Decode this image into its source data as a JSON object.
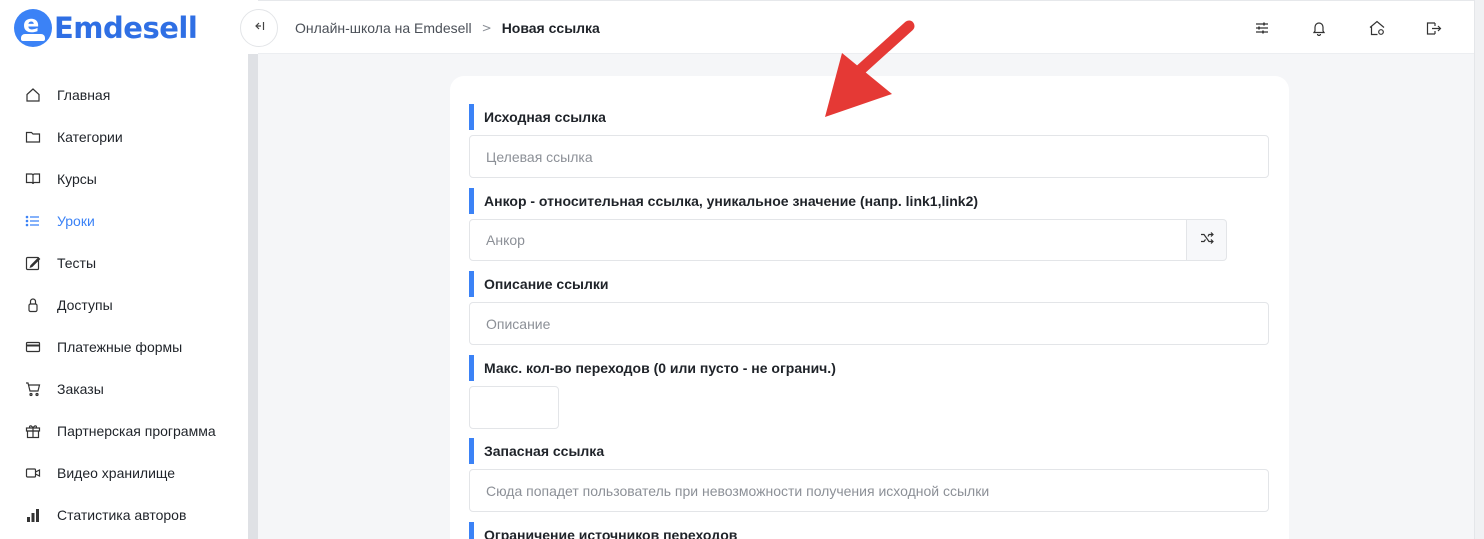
{
  "app": {
    "brand": "Emdesell",
    "accent": "#3b82f6",
    "arrow_color": "#e53935"
  },
  "breadcrumb": {
    "parent": "Онлайн-школа на Emdesell",
    "separator": ">",
    "current": "Новая ссылка"
  },
  "sidebar": {
    "items": [
      {
        "label": "Главная",
        "icon": "home-icon",
        "active": false
      },
      {
        "label": "Категории",
        "icon": "folder-icon",
        "active": false
      },
      {
        "label": "Курсы",
        "icon": "book-icon",
        "active": false
      },
      {
        "label": "Уроки",
        "icon": "list-icon",
        "active": true
      },
      {
        "label": "Тесты",
        "icon": "edit-icon",
        "active": false
      },
      {
        "label": "Доступы",
        "icon": "lock-icon",
        "active": false
      },
      {
        "label": "Платежные формы",
        "icon": "credit-card-icon",
        "active": false
      },
      {
        "label": "Заказы",
        "icon": "cart-icon",
        "active": false
      },
      {
        "label": "Партнерская программа",
        "icon": "gift-icon",
        "active": false
      },
      {
        "label": "Видео хранилище",
        "icon": "video-icon",
        "active": false
      },
      {
        "label": "Статистика авторов",
        "icon": "bar-chart-icon",
        "active": false
      }
    ]
  },
  "header_icons": [
    "sliders-icon",
    "bell-icon",
    "home-settings-icon",
    "logout-icon"
  ],
  "form": {
    "source_link": {
      "label": "Исходная ссылка",
      "placeholder": "Целевая ссылка",
      "value": ""
    },
    "anchor": {
      "label": "Анкор - относительная ссылка, уникальное значение (напр. link1,link2)",
      "placeholder": "Анкор",
      "value": ""
    },
    "description": {
      "label": "Описание ссылки",
      "placeholder": "Описание",
      "value": ""
    },
    "max_transitions": {
      "label": "Макс. кол-во переходов (0 или пусто - не огранич.)",
      "value": ""
    },
    "fallback_link": {
      "label": "Запасная ссылка",
      "placeholder": "Сюда попадет пользователь при невозможности получения исходной ссылки",
      "value": ""
    },
    "source_restriction": {
      "label": "Ограничение источников переходов"
    }
  }
}
